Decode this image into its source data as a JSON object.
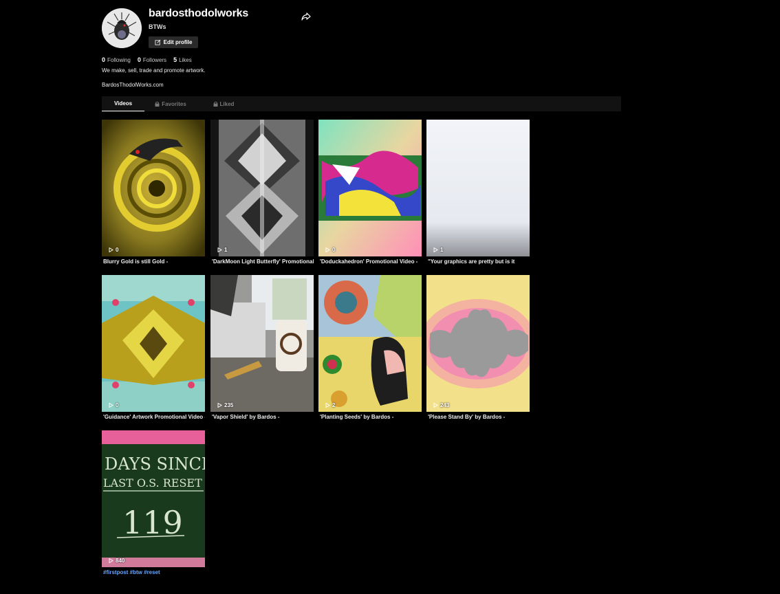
{
  "profile": {
    "username": "bardosthodolworks",
    "nickname": "BTWs",
    "edit_label": "Edit profile",
    "stats": [
      {
        "count": "0",
        "label": "Following"
      },
      {
        "count": "0",
        "label": "Followers"
      },
      {
        "count": "5",
        "label": "Likes"
      }
    ],
    "bio": "We make, sell, trade and promote artwork.",
    "link": "BardosThodolWorks.com"
  },
  "tabs": [
    {
      "label": "Videos",
      "locked": false,
      "active": true
    },
    {
      "label": "Favorites",
      "locked": true,
      "active": false
    },
    {
      "label": "Liked",
      "locked": true,
      "active": false
    }
  ],
  "videos": [
    {
      "views": "0",
      "caption": "Blurry Gold is still Gold -"
    },
    {
      "views": "1",
      "caption": "'DarkMoon Light Butterfly' Promotional"
    },
    {
      "views": "0",
      "caption": "'Doduckahedron' Promotional Video -"
    },
    {
      "views": "1",
      "caption": "\"Your graphics are pretty but is it"
    },
    {
      "views": "0",
      "caption": "'Guidance' Artwork Promotional Video -"
    },
    {
      "views": "235",
      "caption": "'Vapor Shield' by Bardos -"
    },
    {
      "views": "2",
      "caption": "'Planting Seeds' by Bardos -"
    },
    {
      "views": "243",
      "caption": "'Please Stand By' by Bardos -"
    },
    {
      "views": "840",
      "caption": "#firstpost #btw #reset"
    }
  ],
  "thumb_text": {
    "chalk_line1": "DAYS SINCE",
    "chalk_line2": "LAST O.S. RESET",
    "chalk_number": "119"
  },
  "colors": {
    "background": "#000000",
    "tab_bar": "#121212",
    "hashtag": "#6aa6ff"
  },
  "icons": [
    "share-icon",
    "edit-icon",
    "lock-icon",
    "play-icon"
  ]
}
